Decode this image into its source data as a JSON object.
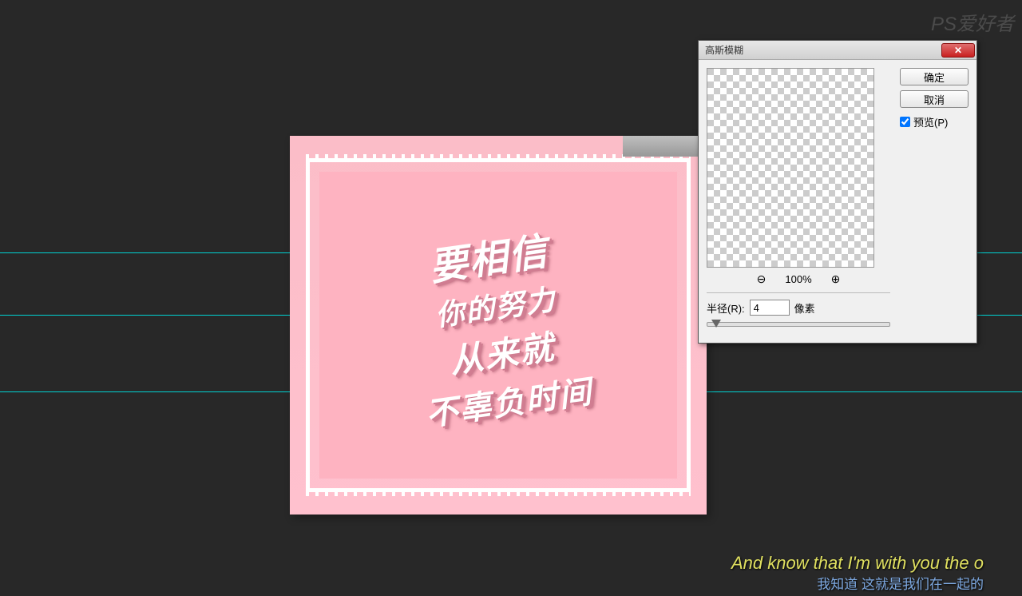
{
  "guides": [
    316,
    394,
    490
  ],
  "canvas": {
    "line1": "要相信",
    "line2": "你的努力",
    "line3": "从来就",
    "line4": "不辜负时间"
  },
  "dialog": {
    "title": "高斯模糊",
    "zoom_level": "100%",
    "radius_label": "半径(R):",
    "radius_value": "4",
    "radius_unit": "像素",
    "ok_label": "确定",
    "cancel_label": "取消",
    "preview_label": "预览(P)"
  },
  "watermark": "PS爱好者",
  "subtitle": {
    "line1": "And know that I'm with you the o",
    "line2": "我知道 这就是我们在一起的"
  }
}
